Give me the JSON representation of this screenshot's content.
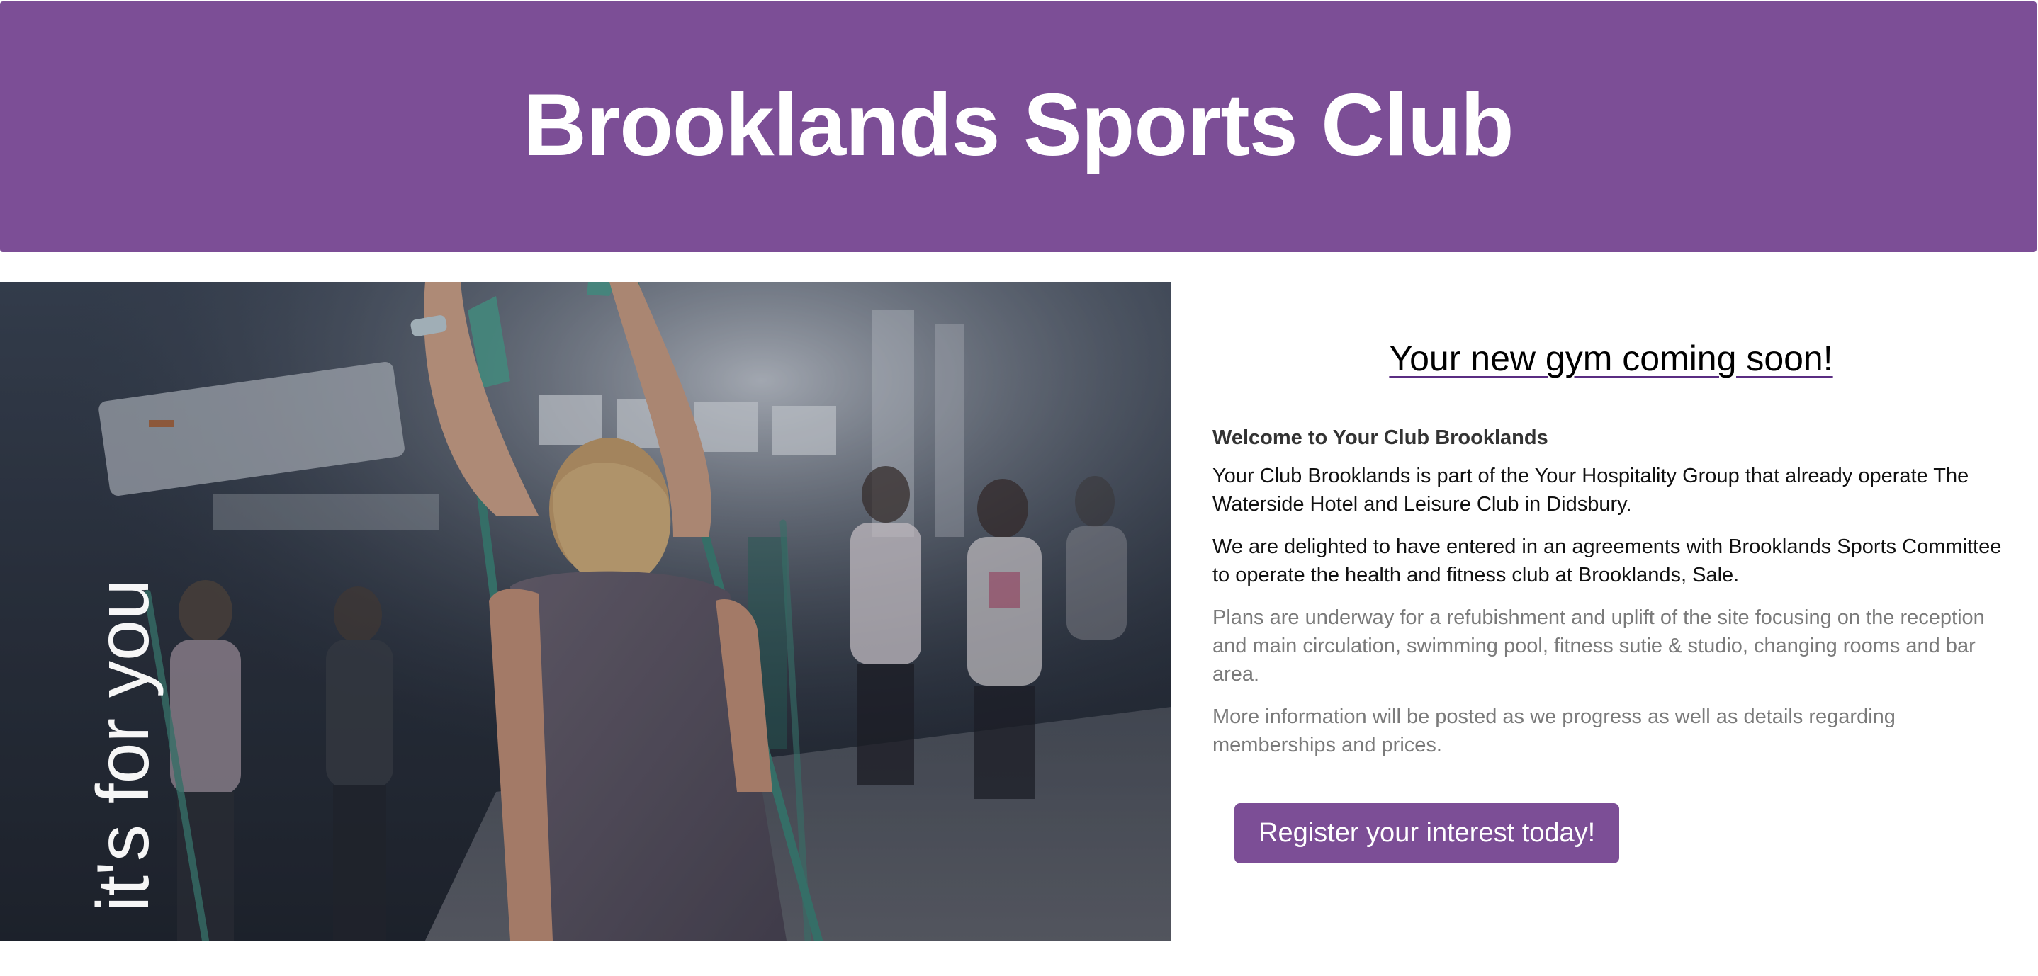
{
  "header": {
    "title": "Brooklands Sports Club"
  },
  "hero": {
    "tagline": "it's for you",
    "image_alt": "Group fitness class with resistance bands"
  },
  "main": {
    "heading": "Your new gym coming soon!",
    "welcome": "Welcome to Your Club Brooklands",
    "paragraphs": [
      "Your Club Brooklands is part of the Your Hospitality Group that already operate The Waterside Hotel and Leisure Club in Didsbury.",
      "We are delighted to have entered in an agreements with Brooklands Sports Committee to operate the health and fitness club at Brooklands, Sale.",
      "Plans are underway for a refubishment and uplift of the site focusing on the reception and main circulation, swimming pool, fitness sutie & studio, changing rooms and bar area.",
      "More information will be posted as we progress as well as details regarding memberships and prices."
    ],
    "cta_label": "Register your interest today!"
  },
  "colors": {
    "brand_purple": "#7c4e96",
    "link_underline": "#5a2d82",
    "muted_text": "#7a7a7a"
  }
}
